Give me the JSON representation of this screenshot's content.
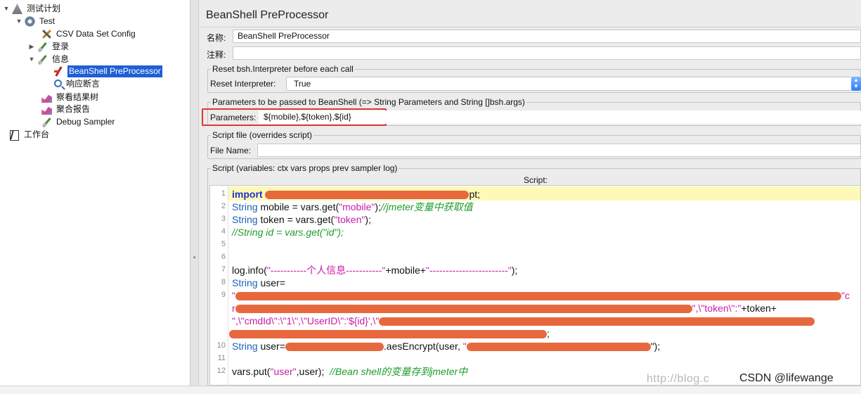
{
  "tree": {
    "plan": "测试计划",
    "test": "Test",
    "csv": "CSV Data Set Config",
    "login": "登录",
    "info": "信息",
    "preprocessor": "BeanShell PreProcessor",
    "assertion": "响应断言",
    "result_tree": "察看结果树",
    "aggregate": "聚合报告",
    "debug": "Debug Sampler",
    "workbench": "工作台"
  },
  "panel": {
    "title": "BeanShell PreProcessor",
    "name_label": "名称:",
    "name_value": "BeanShell PreProcessor",
    "comment_label": "注释:",
    "comment_value": "",
    "reset_group": "Reset bsh.Interpreter before each call",
    "reset_label": "Reset Interpreter:",
    "reset_value": "True",
    "params_group": "Parameters to be passed to BeanShell (=> String Parameters and String []bsh.args)",
    "params_label": "Parameters:",
    "params_value": "${mobile},${token},${id}",
    "file_group": "Script file (overrides script)",
    "file_label": "File Name:",
    "file_value": "",
    "script_group": "Script (variables: ctx vars props prev sampler log)",
    "script_caption": "Script:"
  },
  "script": {
    "line_numbers": [
      "1",
      "2",
      "3",
      "4",
      "5",
      "6",
      "7",
      "8",
      "9",
      "10",
      "11",
      "12"
    ],
    "l1_kw": "import",
    "l1_tail": "pt;",
    "l2_type": "String",
    "l2_code": " mobile = vars.get(",
    "l2_str": "\"mobile\"",
    "l2_end": ");",
    "l2_comment": "//jmeter变量中获取值",
    "l3_type": "String",
    "l3_code": " token = vars.get(",
    "l3_str": "\"token\"",
    "l3_end": ");",
    "l4_comment": "//String id = vars.get(\"id\");",
    "l7_code": "log.info(",
    "l7_str1": "\"-----------个人信息-----------\"",
    "l7_mid": "+mobile+",
    "l7_str2": "\"------------------------\"",
    "l7_end": ");",
    "l8_type": "String",
    "l8_code": " user=",
    "l9a_start": "\"",
    "l9a_end": "\"c",
    "l9b_start": "r",
    "l9b_str": "\",\\\"token\\\":\"",
    "l9b_tail": "+token+",
    "l9c_str": "\",\\\"cmdId\\\":\\\"1\\\",\\\"UserID\\\":'${id}',\\\"",
    "l9d_end": ";",
    "l10_type": "String",
    "l10_code": " user=",
    "l10_mid": ".aesEncrypt(user, ",
    "l10_str": "\"",
    "l10_end": "\");",
    "l12_code": "vars.put(",
    "l12_str": "\"user\"",
    "l12_mid": ",user);",
    "l12_comment": "//Bean shell的变量存到jmeter中"
  },
  "watermark": "http://blog.c",
  "credit": "CSDN @lifewange",
  "colors": {
    "selection": "#1f5fd6",
    "highlight_box": "#e23535",
    "redaction": "#e8683e",
    "current_line": "#fdf9b8"
  }
}
